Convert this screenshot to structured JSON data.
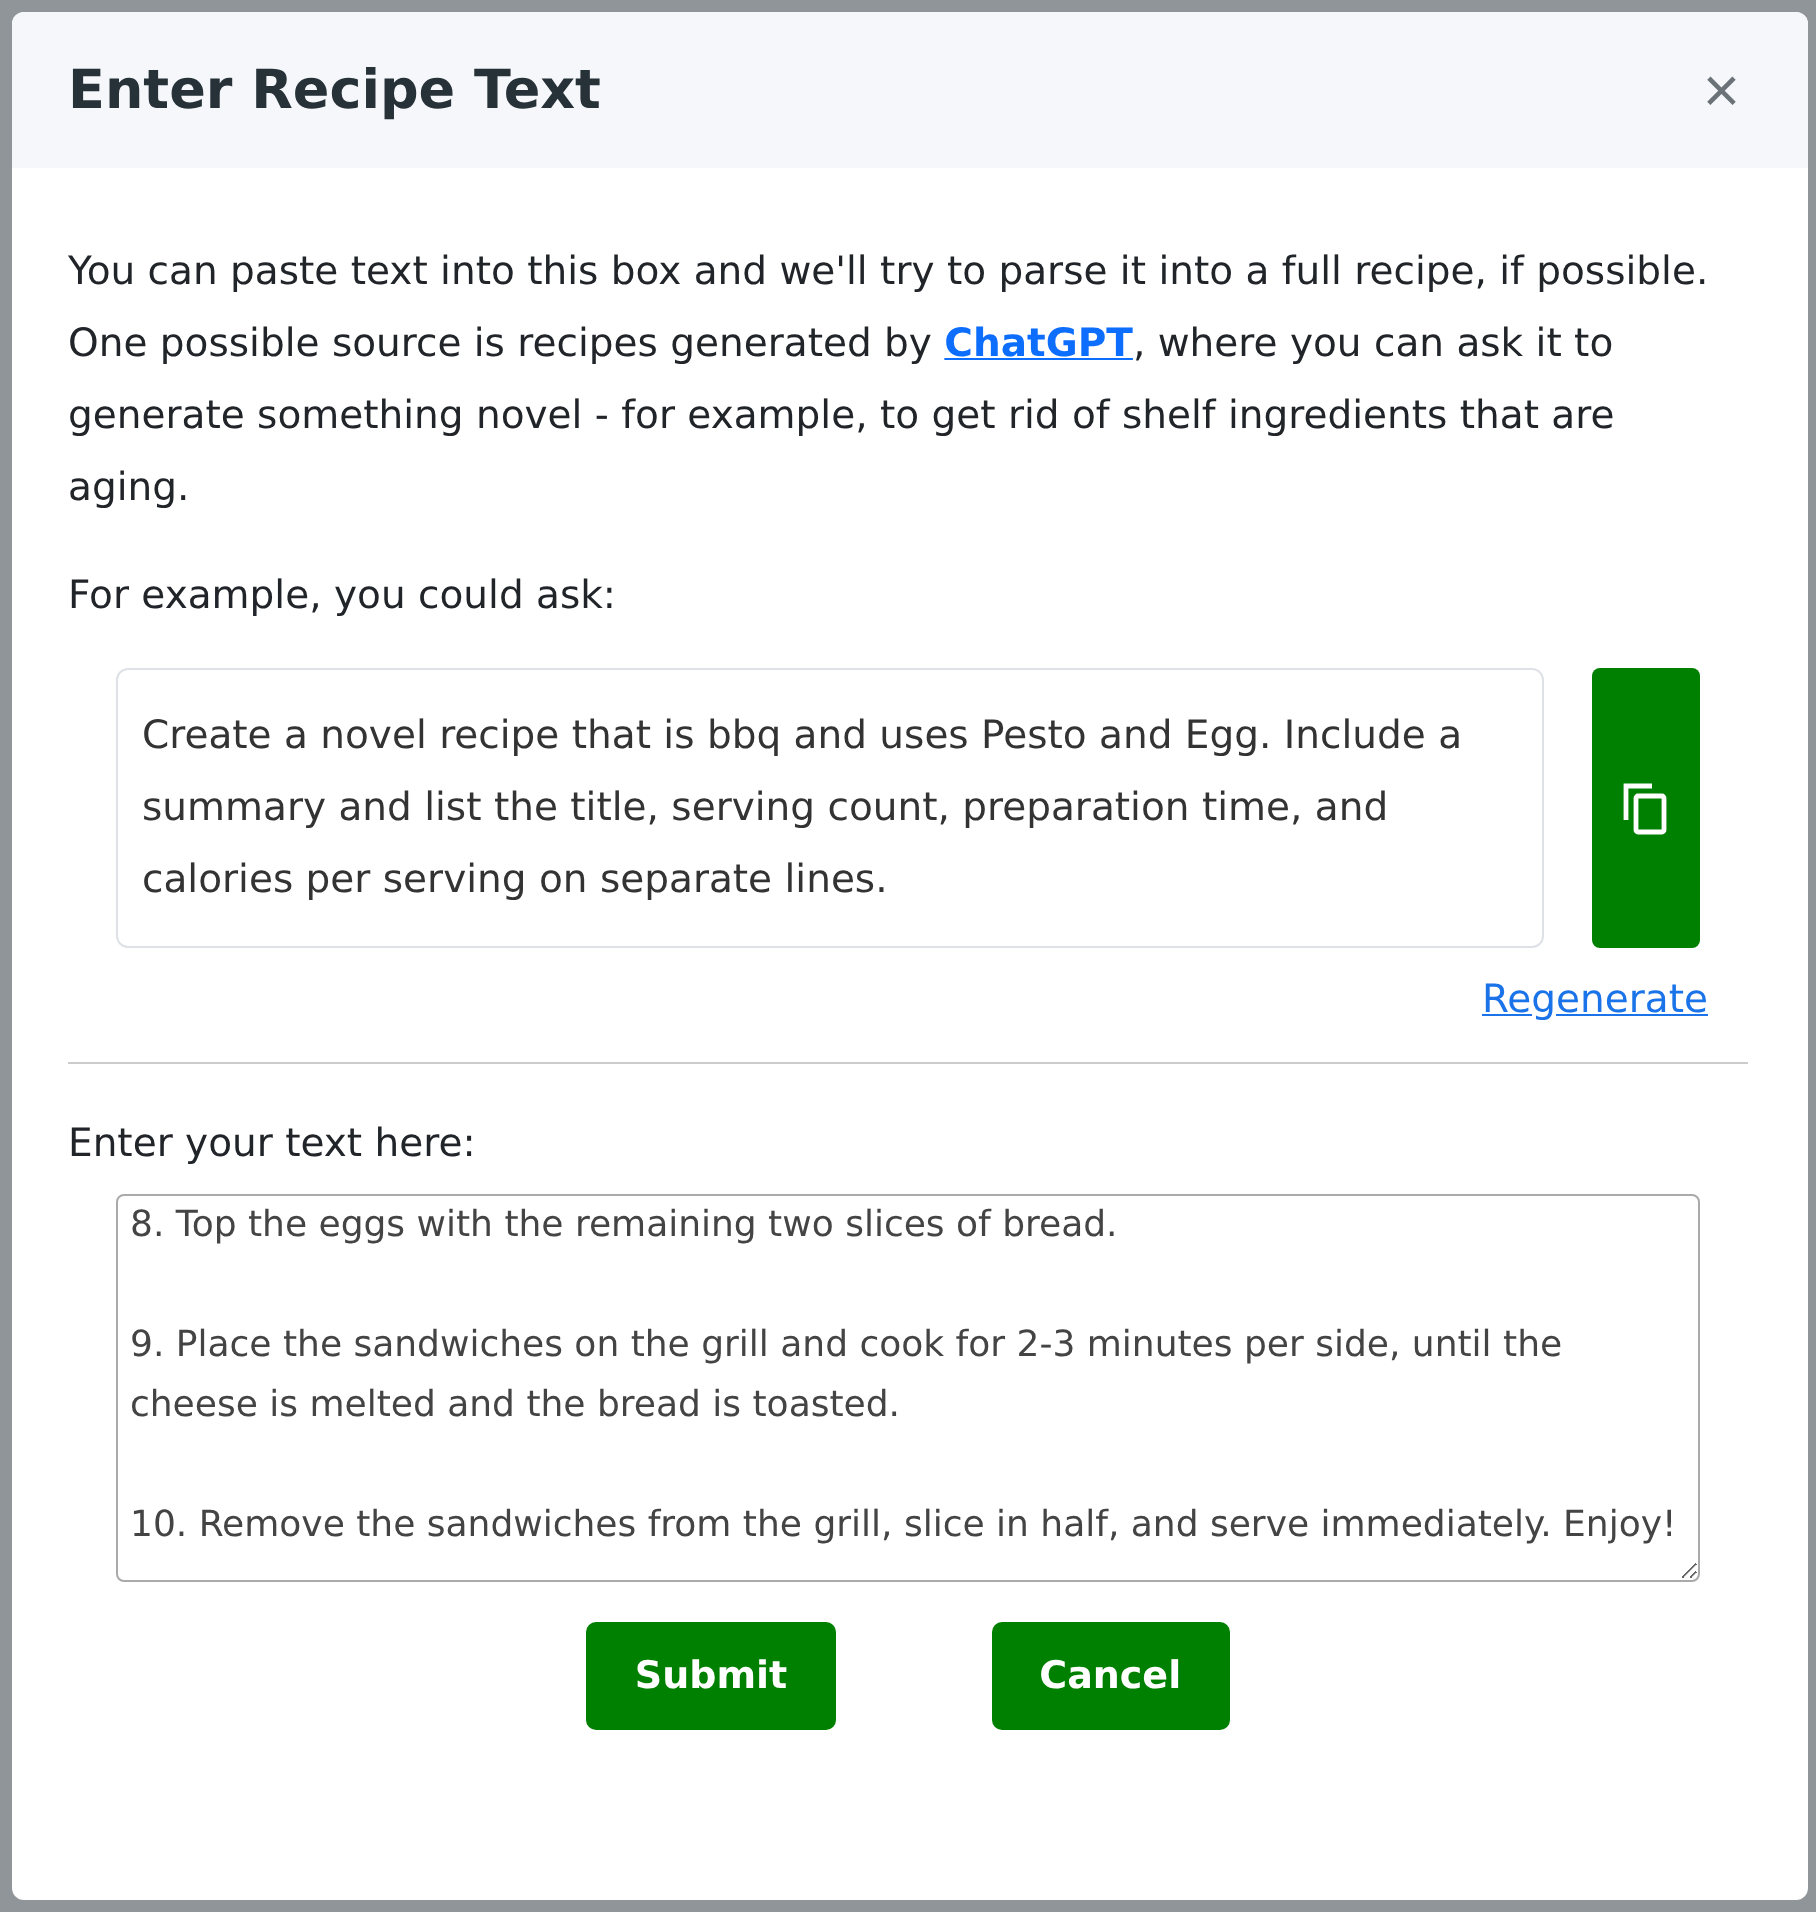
{
  "dialog": {
    "title": "Enter Recipe Text",
    "close_label": "×"
  },
  "intro": "You can paste text into this box and we'll try to parse it into a full recipe, if possible. One possible source is recipes generated by ",
  "intro_link": "ChatGPT",
  "intro_rest": ", where you can ask it to generate something novel - for example, to get rid of shelf ingredients that are aging.",
  "example_label": "For example, you could ask:",
  "prompt": "Create a novel recipe that is bbq and uses Pesto and Egg. Include a summary and list the title, serving count, preparation time, and calories per serving on separate lines.",
  "regenerate": "Regenerate",
  "entry_label": "Enter your text here:",
  "entry_value": "8. Top the eggs with the remaining two slices of bread.\n\n9. Place the sandwiches on the grill and cook for 2-3 minutes per side, until the cheese is melted and the bread is toasted.\n\n10. Remove the sandwiches from the grill, slice in half, and serve immediately. Enjoy!",
  "buttons": [
    "Submit",
    "Cancel"
  ]
}
